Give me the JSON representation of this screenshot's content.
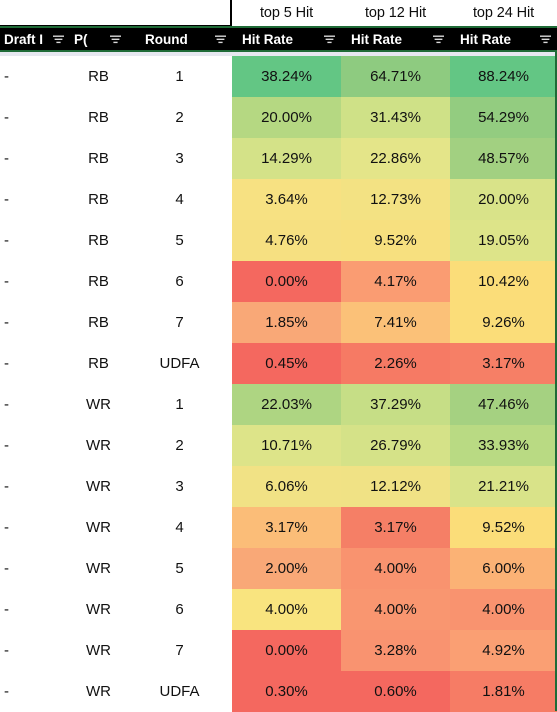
{
  "group_header": {
    "blank": "",
    "columns": [
      "top 5 Hit",
      "top 12 Hit",
      "top 24 Hit"
    ]
  },
  "column_header": {
    "draft": "Draft I",
    "position": "P(",
    "round": "Round",
    "hit_rate_1": "Hit Rate",
    "hit_rate_2": "Hit Rate",
    "hit_rate_3": "Hit Rate",
    "filter_icon": "filter-dropdown-icon"
  },
  "colors": {
    "green_high": "#63c684",
    "green_mid": "#a5d180",
    "green_low": "#c3de85",
    "yellow": "#f5e382",
    "yellow_orange": "#fbd877",
    "orange": "#f9a877",
    "orange_deep": "#f98d6e",
    "red": "#f4685f",
    "header_bg": "#000000",
    "header_border": "#1f6b37"
  },
  "chart_data": {
    "type": "heatmap",
    "title": "Draft Round Hit Rate by Position",
    "columns": [
      "Draft I",
      "P(",
      "Round",
      "top 5 Hit Rate",
      "top 12 Hit Rate",
      "top 24 Hit Rate"
    ],
    "series": [
      {
        "name": "top 5 Hit Rate",
        "values": [
          38.24,
          20.0,
          14.29,
          3.64,
          4.76,
          0.0,
          1.85,
          0.45,
          22.03,
          10.71,
          6.06,
          3.17,
          2.0,
          4.0,
          0.0,
          0.3
        ]
      },
      {
        "name": "top 12 Hit Rate",
        "values": [
          64.71,
          31.43,
          22.86,
          12.73,
          9.52,
          4.17,
          7.41,
          2.26,
          37.29,
          26.79,
          12.12,
          3.17,
          4.0,
          4.0,
          3.28,
          0.6
        ]
      },
      {
        "name": "top 24 Hit Rate",
        "values": [
          88.24,
          54.29,
          48.57,
          20.0,
          19.05,
          10.42,
          9.26,
          3.17,
          47.46,
          33.93,
          21.21,
          9.52,
          6.0,
          4.0,
          4.92,
          1.81
        ]
      }
    ],
    "categories": [
      "RB 1",
      "RB 2",
      "RB 3",
      "RB 4",
      "RB 5",
      "RB 6",
      "RB 7",
      "RB UDFA",
      "WR 1",
      "WR 2",
      "WR 3",
      "WR 4",
      "WR 5",
      "WR 6",
      "WR 7",
      "WR UDFA"
    ]
  },
  "rows": [
    {
      "draft": "-",
      "position": "RB",
      "round": "1",
      "v1": "38.24%",
      "v2": "64.71%",
      "v3": "88.24%",
      "c1": "#63c684",
      "c2": "#8ecb80",
      "c3": "#63c684"
    },
    {
      "draft": "-",
      "position": "RB",
      "round": "2",
      "v1": "20.00%",
      "v2": "31.43%",
      "v3": "54.29%",
      "c1": "#b5d882",
      "c2": "#cfe187",
      "c3": "#93cc80"
    },
    {
      "draft": "-",
      "position": "RB",
      "round": "3",
      "v1": "14.29%",
      "v2": "22.86%",
      "v3": "48.57%",
      "c1": "#d4e288",
      "c2": "#e4e589",
      "c3": "#a2d081"
    },
    {
      "draft": "-",
      "position": "RB",
      "round": "4",
      "v1": "3.64%",
      "v2": "12.73%",
      "v3": "20.00%",
      "c1": "#f7e182",
      "c2": "#f3e283",
      "c3": "#d9e389"
    },
    {
      "draft": "-",
      "position": "RB",
      "round": "5",
      "v1": "4.76%",
      "v2": "9.52%",
      "v3": "19.05%",
      "c1": "#f6e081",
      "c2": "#f7e07f",
      "c3": "#dde489"
    },
    {
      "draft": "-",
      "position": "RB",
      "round": "6",
      "v1": "0.00%",
      "v2": "4.17%",
      "v3": "10.42%",
      "c1": "#f4685f",
      "c2": "#fa9c72",
      "c3": "#fbdd79"
    },
    {
      "draft": "-",
      "position": "RB",
      "round": "7",
      "v1": "1.85%",
      "v2": "7.41%",
      "v3": "9.26%",
      "c1": "#f9a877",
      "c2": "#fbc178",
      "c3": "#fbdd79"
    },
    {
      "draft": "-",
      "position": "RB",
      "round": "UDFA",
      "v1": "0.45%",
      "v2": "2.26%",
      "v3": "3.17%",
      "c1": "#f4685f",
      "c2": "#f67a64",
      "c3": "#f67f66"
    },
    {
      "draft": "-",
      "position": "WR",
      "round": "1",
      "v1": "22.03%",
      "v2": "37.29%",
      "v3": "47.46%",
      "c1": "#aed582",
      "c2": "#c6de86",
      "c3": "#a5d181"
    },
    {
      "draft": "-",
      "position": "WR",
      "round": "2",
      "v1": "10.71%",
      "v2": "26.79%",
      "v3": "33.93%",
      "c1": "#dde489",
      "c2": "#d5e288",
      "c3": "#b9da83"
    },
    {
      "draft": "-",
      "position": "WR",
      "round": "3",
      "v1": "6.06%",
      "v2": "12.12%",
      "v3": "21.21%",
      "c1": "#f1e285",
      "c2": "#f0e285",
      "c3": "#d9e389"
    },
    {
      "draft": "-",
      "position": "WR",
      "round": "4",
      "v1": "3.17%",
      "v2": "3.17%",
      "v3": "9.52%",
      "c1": "#fbbd78",
      "c2": "#f57f66",
      "c3": "#fbdd79"
    },
    {
      "draft": "-",
      "position": "WR",
      "round": "5",
      "v1": "2.00%",
      "v2": "4.00%",
      "v3": "6.00%",
      "c1": "#f9a877",
      "c2": "#f9936f",
      "c3": "#fbb275"
    },
    {
      "draft": "-",
      "position": "WR",
      "round": "6",
      "v1": "4.00%",
      "v2": "4.00%",
      "v3": "4.00%",
      "c1": "#f9e47f",
      "c2": "#f99670",
      "c3": "#f9936f"
    },
    {
      "draft": "-",
      "position": "WR",
      "round": "7",
      "v1": "0.00%",
      "v2": "3.28%",
      "v3": "4.92%",
      "c1": "#f4685f",
      "c2": "#f99370",
      "c3": "#fa9f73"
    },
    {
      "draft": "-",
      "position": "WR",
      "round": "UDFA",
      "v1": "0.30%",
      "v2": "0.60%",
      "v3": "1.81%",
      "c1": "#f4685f",
      "c2": "#f4685f",
      "c3": "#f67c65"
    }
  ]
}
